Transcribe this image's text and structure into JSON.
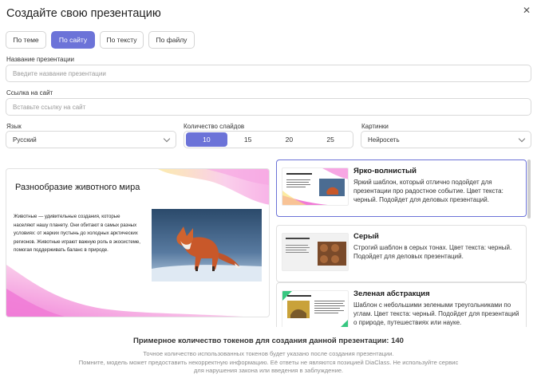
{
  "dialog": {
    "title": "Создайте свою презентацию",
    "close_icon": "close-icon"
  },
  "tabs": [
    {
      "label": "По теме",
      "active": false
    },
    {
      "label": "По сайту",
      "active": true
    },
    {
      "label": "По тексту",
      "active": false
    },
    {
      "label": "По файлу",
      "active": false
    }
  ],
  "form": {
    "name_label": "Название презентации",
    "name_placeholder": "Введите название презентации",
    "url_label": "Ссылка на сайт",
    "url_placeholder": "Вставьте ссылку на сайт",
    "language_label": "Язык",
    "language_value": "Русский",
    "slides_label": "Количество слайдов",
    "slides_options": [
      "10",
      "15",
      "20",
      "25"
    ],
    "slides_selected": "10",
    "images_label": "Картинки",
    "images_value": "Нейросеть"
  },
  "preview": {
    "title": "Разнообразие животного мира",
    "text": "Животные — удивительные создания, которые населяют нашу планету. Они обитают в самых разных условиях: от жарких пустынь до холодных арктических регионов. Животные играют важную роль в экосистеме, помогая поддерживать баланс в природе."
  },
  "templates": [
    {
      "name": "Ярко-волнистый",
      "description": "Яркий шаблон, который отлично подойдет для презентации про радостное событие. Цвет текста: черный. Подойдет для деловых презентаций.",
      "selected": true
    },
    {
      "name": "Серый",
      "description": "Строгий шаблон в серых тонах. Цвет текста: черный. Подойдет для деловых презентаций.",
      "selected": false
    },
    {
      "name": "Зеленая абстракция",
      "description": "Шаблон с небольшими зелеными треугольниками по углам. Цвет текста: черный. Подойдет для презентаций о природе, путешествиях или науке.",
      "selected": false
    }
  ],
  "footer": {
    "tokens": "Примерное количество токенов для создания данной презентации: 140",
    "note_line1": "Точное количество использованных токенов будет указано после создания презентации.",
    "note_line2": "Помните, модель может предоставить некорректную информацию. Её ответы не являются позицией DiaClass. Не используйте сервис",
    "note_line3": "для нарушения закона или введения в заблуждение."
  },
  "colors": {
    "accent": "#6c73d8",
    "border": "#d9d9d9",
    "wave_pink": "#f07ad6",
    "wave_yellow": "#fbe27a",
    "green": "#38c781"
  }
}
